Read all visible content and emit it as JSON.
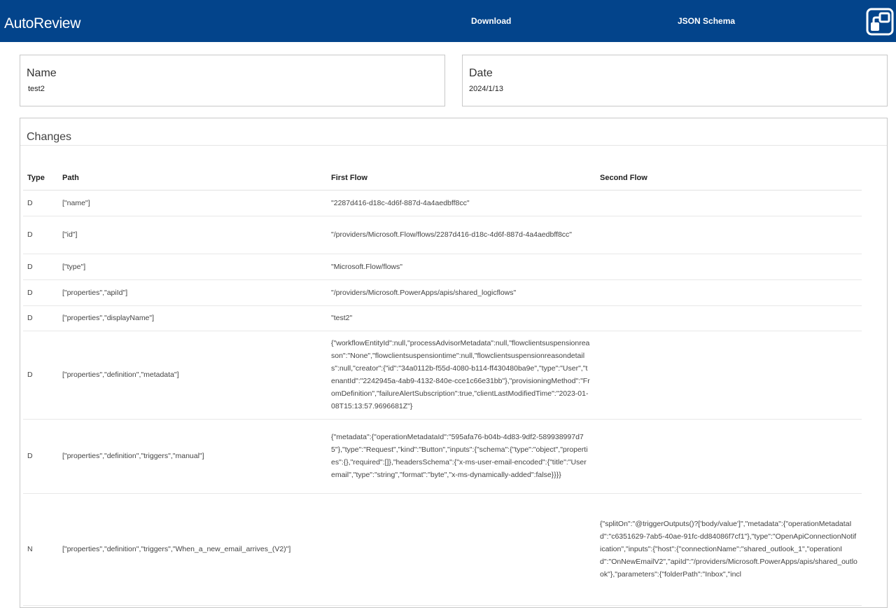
{
  "header": {
    "app_title": "AutoReview",
    "nav": {
      "download": "Download",
      "json_schema": "JSON Schema"
    },
    "logo_icon": "app-logo-icon",
    "background_color": "#03448b"
  },
  "name_card": {
    "label": "Name",
    "value": "test2"
  },
  "date_card": {
    "label": "Date",
    "value": "2024/1/13"
  },
  "changes": {
    "title": "Changes",
    "columns": {
      "type": "Type",
      "path": "Path",
      "first_flow": "First Flow",
      "second_flow": "Second Flow"
    },
    "rows": [
      {
        "type": "D",
        "path": "[\"name\"]",
        "first": "\"2287d416-d18c-4d6f-887d-4a4aedbff8cc\"",
        "second": ""
      },
      {
        "type": "D",
        "path": "[\"id\"]",
        "first": "\"/providers/Microsoft.Flow/flows/2287d416-d18c-4d6f-887d-4a4aedbff8cc\"",
        "second": ""
      },
      {
        "type": "D",
        "path": "[\"type\"]",
        "first": "\"Microsoft.Flow/flows\"",
        "second": ""
      },
      {
        "type": "D",
        "path": "[\"properties\",\"apiId\"]",
        "first": "\"/providers/Microsoft.PowerApps/apis/shared_logicflows\"",
        "second": ""
      },
      {
        "type": "D",
        "path": "[\"properties\",\"displayName\"]",
        "first": "\"test2\"",
        "second": ""
      },
      {
        "type": "D",
        "path": "[\"properties\",\"definition\",\"metadata\"]",
        "first": "{\"workflowEntityId\":null,\"processAdvisorMetadata\":null,\"flowclientsuspensionreason\":\"None\",\"flowclientsuspensiontime\":null,\"flowclientsuspensionreasondetails\":null,\"creator\":{\"id\":\"34a0112b-f55d-4080-b114-ff430480ba9e\",\"type\":\"User\",\"tenantId\":\"2242945a-4ab9-4132-840e-cce1c66e31bb\"},\"provisioningMethod\":\"FromDefinition\",\"failureAlertSubscription\":true,\"clientLastModifiedTime\":\"2023-01-08T15:13:57.9696681Z\"}",
        "second": ""
      },
      {
        "type": "D",
        "path": "[\"properties\",\"definition\",\"triggers\",\"manual\"]",
        "first": "{\"metadata\":{\"operationMetadataId\":\"595afa76-b04b-4d83-9df2-589938997d75\"},\"type\":\"Request\",\"kind\":\"Button\",\"inputs\":{\"schema\":{\"type\":\"object\",\"properties\":{},\"required\":[]},\"headersSchema\":{\"x-ms-user-email-encoded\":{\"title\":\"User email\",\"type\":\"string\",\"format\":\"byte\",\"x-ms-dynamically-added\":false}}}}",
        "second": ""
      },
      {
        "type": "N",
        "path": "[\"properties\",\"definition\",\"triggers\",\"When_a_new_email_arrives_(V2)\"]",
        "first": "",
        "second": "{\"splitOn\":\"@triggerOutputs()?['body/value']\",\"metadata\":{\"operationMetadataId\":\"c6351629-7ab5-40ae-91fc-dd84086f7cf1\"},\"type\":\"OpenApiConnectionNotification\",\"inputs\":{\"host\":{\"connectionName\":\"shared_outlook_1\",\"operationId\":\"OnNewEmailV2\",\"apiId\":\"/providers/Microsoft.PowerApps/apis/shared_outlook\"},\"parameters\":{\"folderPath\":\"Inbox\",\"incl"
      }
    ]
  }
}
